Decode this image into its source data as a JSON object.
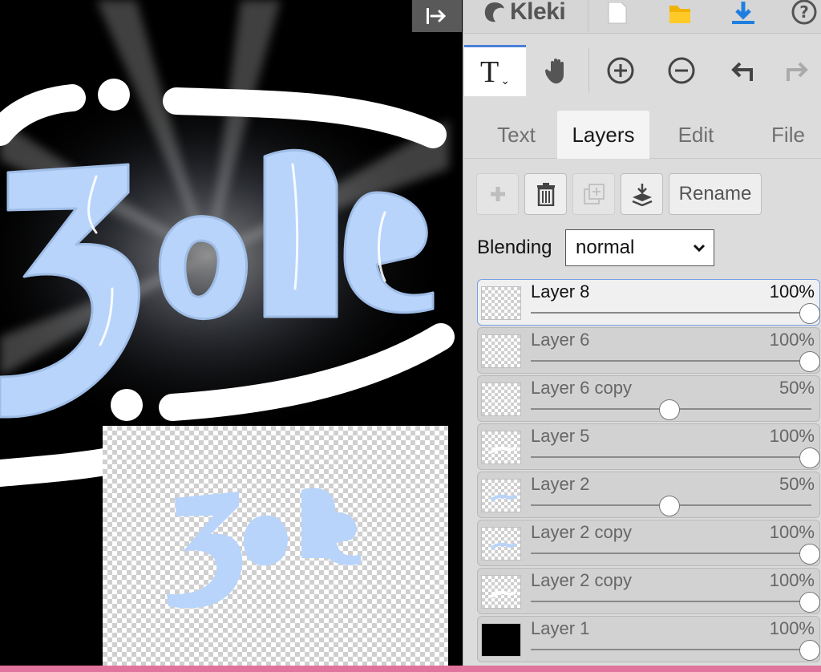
{
  "app": {
    "logo_text": "Kleki"
  },
  "toolbar": {
    "active_tool": "T"
  },
  "tabs": [
    {
      "label": "Text",
      "active": false
    },
    {
      "label": "Layers",
      "active": true
    },
    {
      "label": "Edit",
      "active": false
    },
    {
      "label": "File",
      "active": false
    }
  ],
  "actions": {
    "rename_label": "Rename"
  },
  "blending": {
    "label": "Blending",
    "value": "normal"
  },
  "layers": [
    {
      "name": "Layer 8",
      "opacity_label": "100%",
      "opacity": 1.0,
      "selected": true,
      "thumb": "empty"
    },
    {
      "name": "Layer 6",
      "opacity_label": "100%",
      "opacity": 1.0,
      "selected": false,
      "thumb": "empty"
    },
    {
      "name": "Layer 6 copy",
      "opacity_label": "50%",
      "opacity": 0.5,
      "selected": false,
      "thumb": "empty"
    },
    {
      "name": "Layer 5",
      "opacity_label": "100%",
      "opacity": 1.0,
      "selected": false,
      "thumb": "faint"
    },
    {
      "name": "Layer 2",
      "opacity_label": "50%",
      "opacity": 0.5,
      "selected": false,
      "thumb": "blue"
    },
    {
      "name": "Layer 2 copy",
      "opacity_label": "100%",
      "opacity": 1.0,
      "selected": false,
      "thumb": "blue"
    },
    {
      "name": "Layer 2 copy",
      "opacity_label": "100%",
      "opacity": 1.0,
      "selected": false,
      "thumb": "faint"
    },
    {
      "name": "Layer 1",
      "opacity_label": "100%",
      "opacity": 1.0,
      "selected": false,
      "thumb": "black"
    }
  ],
  "canvas": {
    "artwork_text": "3ole",
    "colors": {
      "lettering": "#b8d4fb",
      "background": "#000000",
      "frame": "#ffffff"
    }
  },
  "colors": {
    "accent": "#4a7fd8",
    "download_icon": "#1f7fe0",
    "folder_icon": "#f0b400",
    "bottom_strip": "#e0749c"
  }
}
